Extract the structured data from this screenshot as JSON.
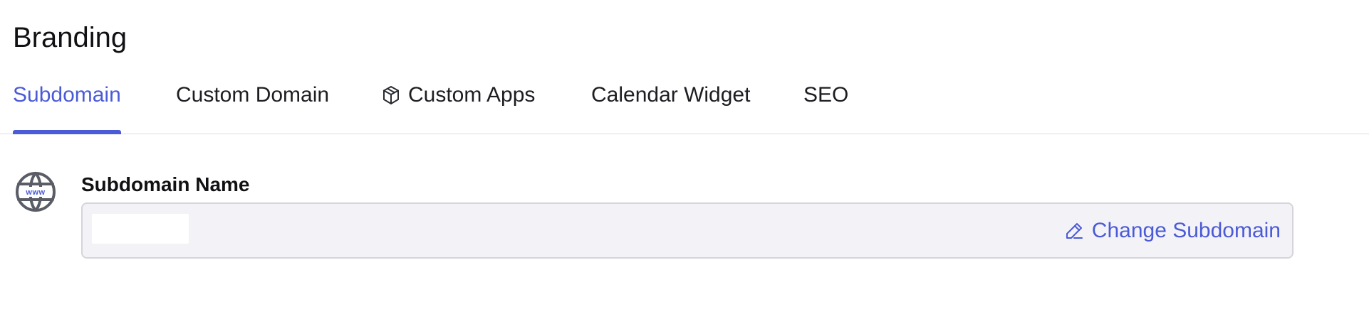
{
  "page": {
    "title": "Branding"
  },
  "tabs": [
    {
      "label": "Subdomain",
      "active": true,
      "icon": null
    },
    {
      "label": "Custom Domain",
      "active": false,
      "icon": null
    },
    {
      "label": "Custom Apps",
      "active": false,
      "icon": "cube-icon"
    },
    {
      "label": "Calendar Widget",
      "active": false,
      "icon": null
    },
    {
      "label": "SEO",
      "active": false,
      "icon": null
    }
  ],
  "subdomain": {
    "icon": "globe-www-icon",
    "label": "Subdomain Name",
    "value": "",
    "action": {
      "label": "Change Subdomain",
      "icon": "pencil-icon"
    }
  },
  "colors": {
    "accent": "#4b5ad6",
    "text": "#1b1b1f",
    "field_bg": "#f3f3f7",
    "border": "#d4d4dc",
    "icon_gray": "#5a5d66"
  }
}
